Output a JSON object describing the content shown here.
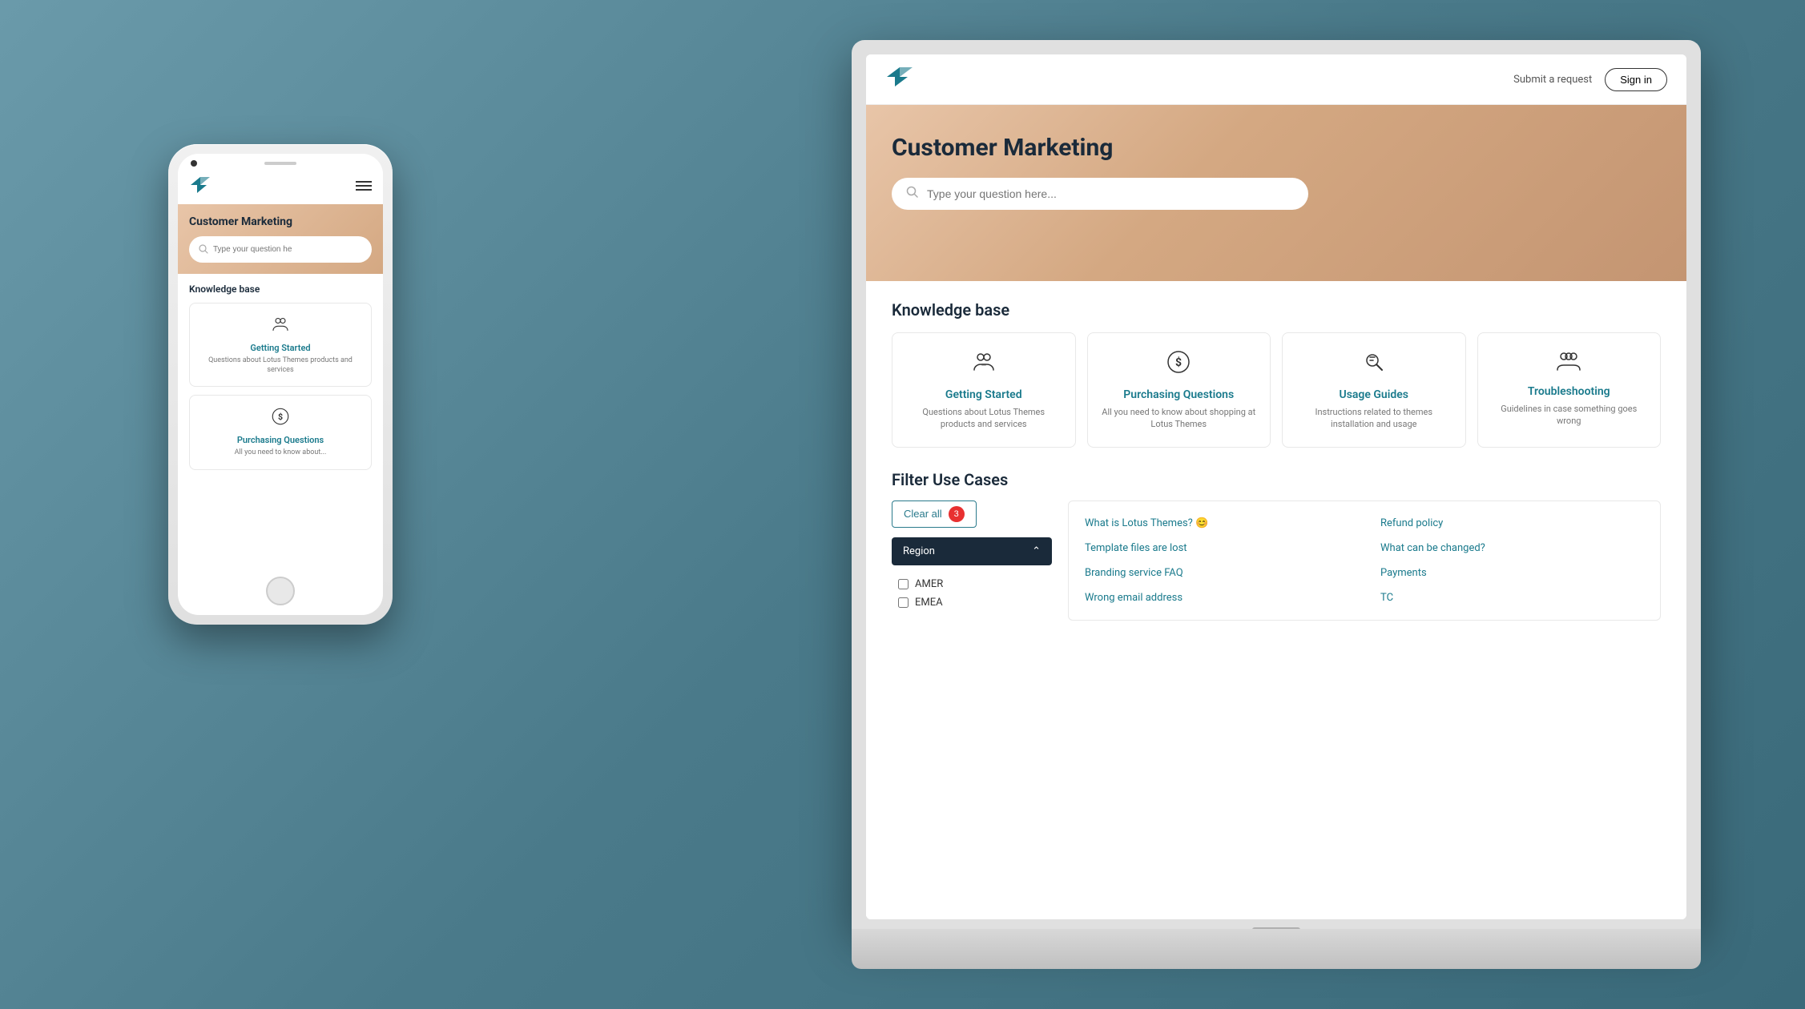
{
  "site": {
    "title": "Customer Marketing",
    "logo_text": "Z",
    "nav": {
      "submit_request": "Submit a request",
      "sign_in": "Sign in"
    },
    "search": {
      "placeholder": "Type your question here..."
    },
    "knowledge_base": {
      "section_title": "Knowledge base",
      "cards": [
        {
          "id": "getting-started",
          "icon": "👥",
          "title": "Getting Started",
          "description": "Questions about Lotus Themes products and services"
        },
        {
          "id": "purchasing",
          "icon": "💰",
          "title": "Purchasing Questions",
          "description": "All you need to know about shopping at Lotus Themes"
        },
        {
          "id": "usage-guides",
          "icon": "🔑",
          "title": "Usage Guides",
          "description": "Instructions related to themes installation and usage"
        },
        {
          "id": "troubleshooting",
          "icon": "👤",
          "title": "Troubleshooting",
          "description": "Guidelines in case something goes wrong"
        }
      ]
    },
    "filter": {
      "section_title": "Filter Use Cases",
      "clear_all": "Clear all",
      "badge_count": "3",
      "region_label": "Region",
      "options": [
        "AMER",
        "EMEA"
      ]
    },
    "articles": [
      {
        "title": "What is Lotus Themes? 😊",
        "col": 1
      },
      {
        "title": "Refund policy",
        "col": 2
      },
      {
        "title": "Template files are lost",
        "col": 1
      },
      {
        "title": "What can be changed?",
        "col": 2
      },
      {
        "title": "Branding service FAQ",
        "col": 1
      },
      {
        "title": "Payments",
        "col": 2
      },
      {
        "title": "Wrong email address",
        "col": 1
      },
      {
        "title": "TC",
        "col": 2
      }
    ]
  },
  "phone": {
    "title": "Customer Marketing",
    "search_placeholder": "Type your question he",
    "section_title": "Knowledge base",
    "cards": [
      {
        "icon": "👥",
        "title": "Getting Started",
        "description": "Questions about Lotus Themes products and services"
      },
      {
        "icon": "💰",
        "title": "Purchasing Questions",
        "description": "All you need to know about..."
      }
    ]
  },
  "colors": {
    "accent": "#1a7a8c",
    "dark_nav": "#1a2a3a",
    "hero_bg": "#e8c5a8",
    "badge_red": "#e83030"
  }
}
